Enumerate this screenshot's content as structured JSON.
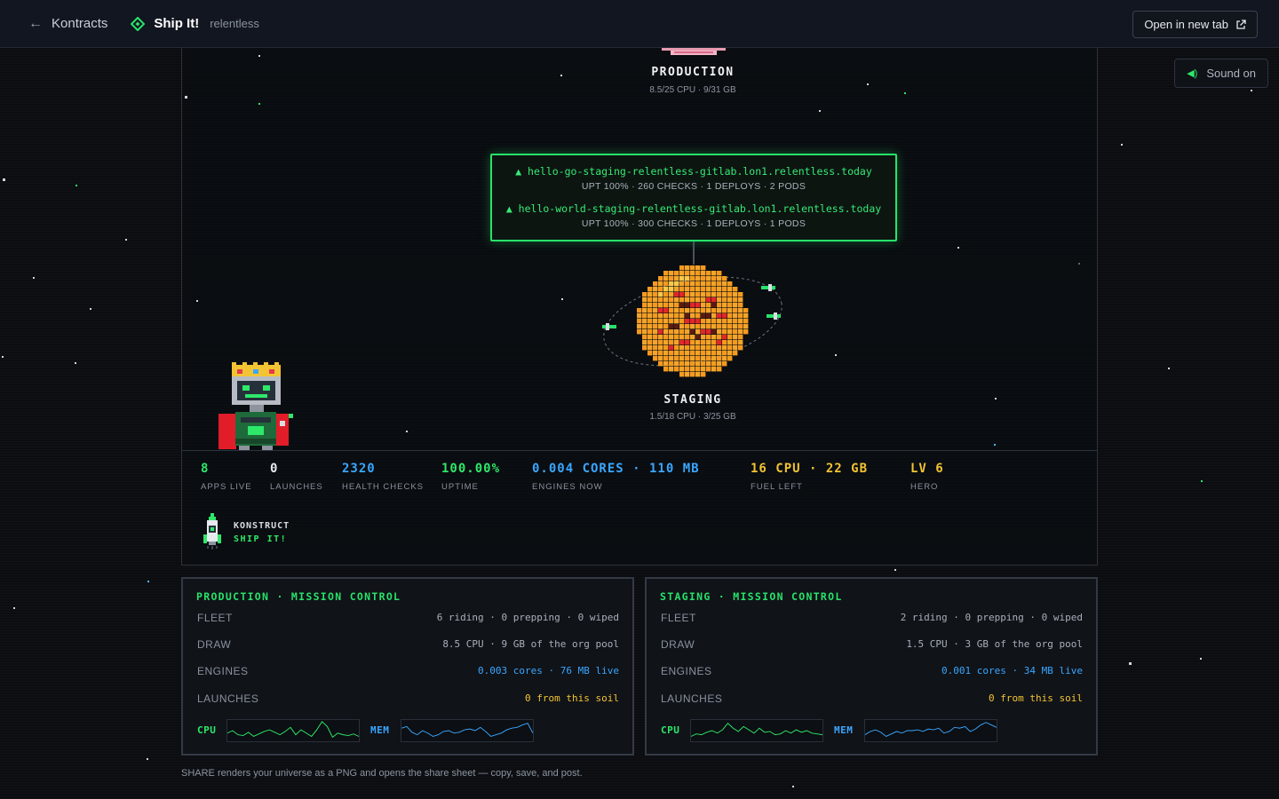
{
  "topbar": {
    "back_label": "Kontracts",
    "app_name": "Ship It!",
    "org": "relentless",
    "open_new_tab": "Open in new tab"
  },
  "sound_label": "Sound on",
  "universe": {
    "production": {
      "label": "PRODUCTION",
      "sub": "8.5/25 CPU · 9/31 GB"
    },
    "staging": {
      "label": "STAGING",
      "sub": "1.5/18 CPU · 3/25 GB"
    },
    "tooltip": [
      {
        "host": "▲ hello-go-staging-relentless-gitlab.lon1.relentless.today",
        "stats": "UPT 100% · 260 CHECKS · 1 DEPLOYS · 2 PODS"
      },
      {
        "host": "▲ hello-world-staging-relentless-gitlab.lon1.relentless.today",
        "stats": "UPT 100% · 300 CHECKS · 1 DEPLOYS · 1 PODS"
      }
    ]
  },
  "stats": [
    {
      "value": "8",
      "label": "APPS LIVE",
      "color": "#2ee86a"
    },
    {
      "value": "0",
      "label": "LAUNCHES",
      "color": "#e6e9ee"
    },
    {
      "value": "2320",
      "label": "HEALTH CHECKS",
      "color": "#3aa6ff"
    },
    {
      "value": "100.00%",
      "label": "UPTIME",
      "color": "#2ee86a"
    },
    {
      "value": "0.004 CORES · 110 MB",
      "label": "ENGINES NOW",
      "color": "#3aa6ff"
    },
    {
      "value": "16 CPU · 22 GB",
      "label": "FUEL LEFT",
      "color": "#f2c433"
    },
    {
      "value": "LV 6",
      "label": "HERO",
      "color": "#f2c433"
    }
  ],
  "brand_block": {
    "line1": "KONSTRUCT",
    "line2": "SHIP IT!"
  },
  "mission_control": [
    {
      "title": "PRODUCTION · MISSION CONTROL",
      "rows": [
        {
          "key": "FLEET",
          "value": "6 riding · 0 prepping · 0 wiped"
        },
        {
          "key": "DRAW",
          "value": "8.5 CPU · 9 GB of the org pool"
        },
        {
          "key": "ENGINES",
          "value": "0.003 cores · 76 MB live"
        },
        {
          "key": "LAUNCHES",
          "value": "0 from this soil"
        }
      ],
      "cpu_label": "CPU",
      "mem_label": "MEM"
    },
    {
      "title": "STAGING · MISSION CONTROL",
      "rows": [
        {
          "key": "FLEET",
          "value": "2 riding · 0 prepping · 0 wiped"
        },
        {
          "key": "DRAW",
          "value": "1.5 CPU · 3 GB of the org pool"
        },
        {
          "key": "ENGINES",
          "value": "0.001 cores · 34 MB live"
        },
        {
          "key": "LAUNCHES",
          "value": "0 from this soil"
        }
      ],
      "cpu_label": "CPU",
      "mem_label": "MEM"
    }
  ],
  "footer_note": "SHARE renders your universe as a PNG and opens the share sheet — copy, save, and post.",
  "colors": {
    "accent_green": "#27e36a",
    "blue": "#3aa6ff",
    "yellow": "#f2c433",
    "bg": "#0b0d11"
  }
}
